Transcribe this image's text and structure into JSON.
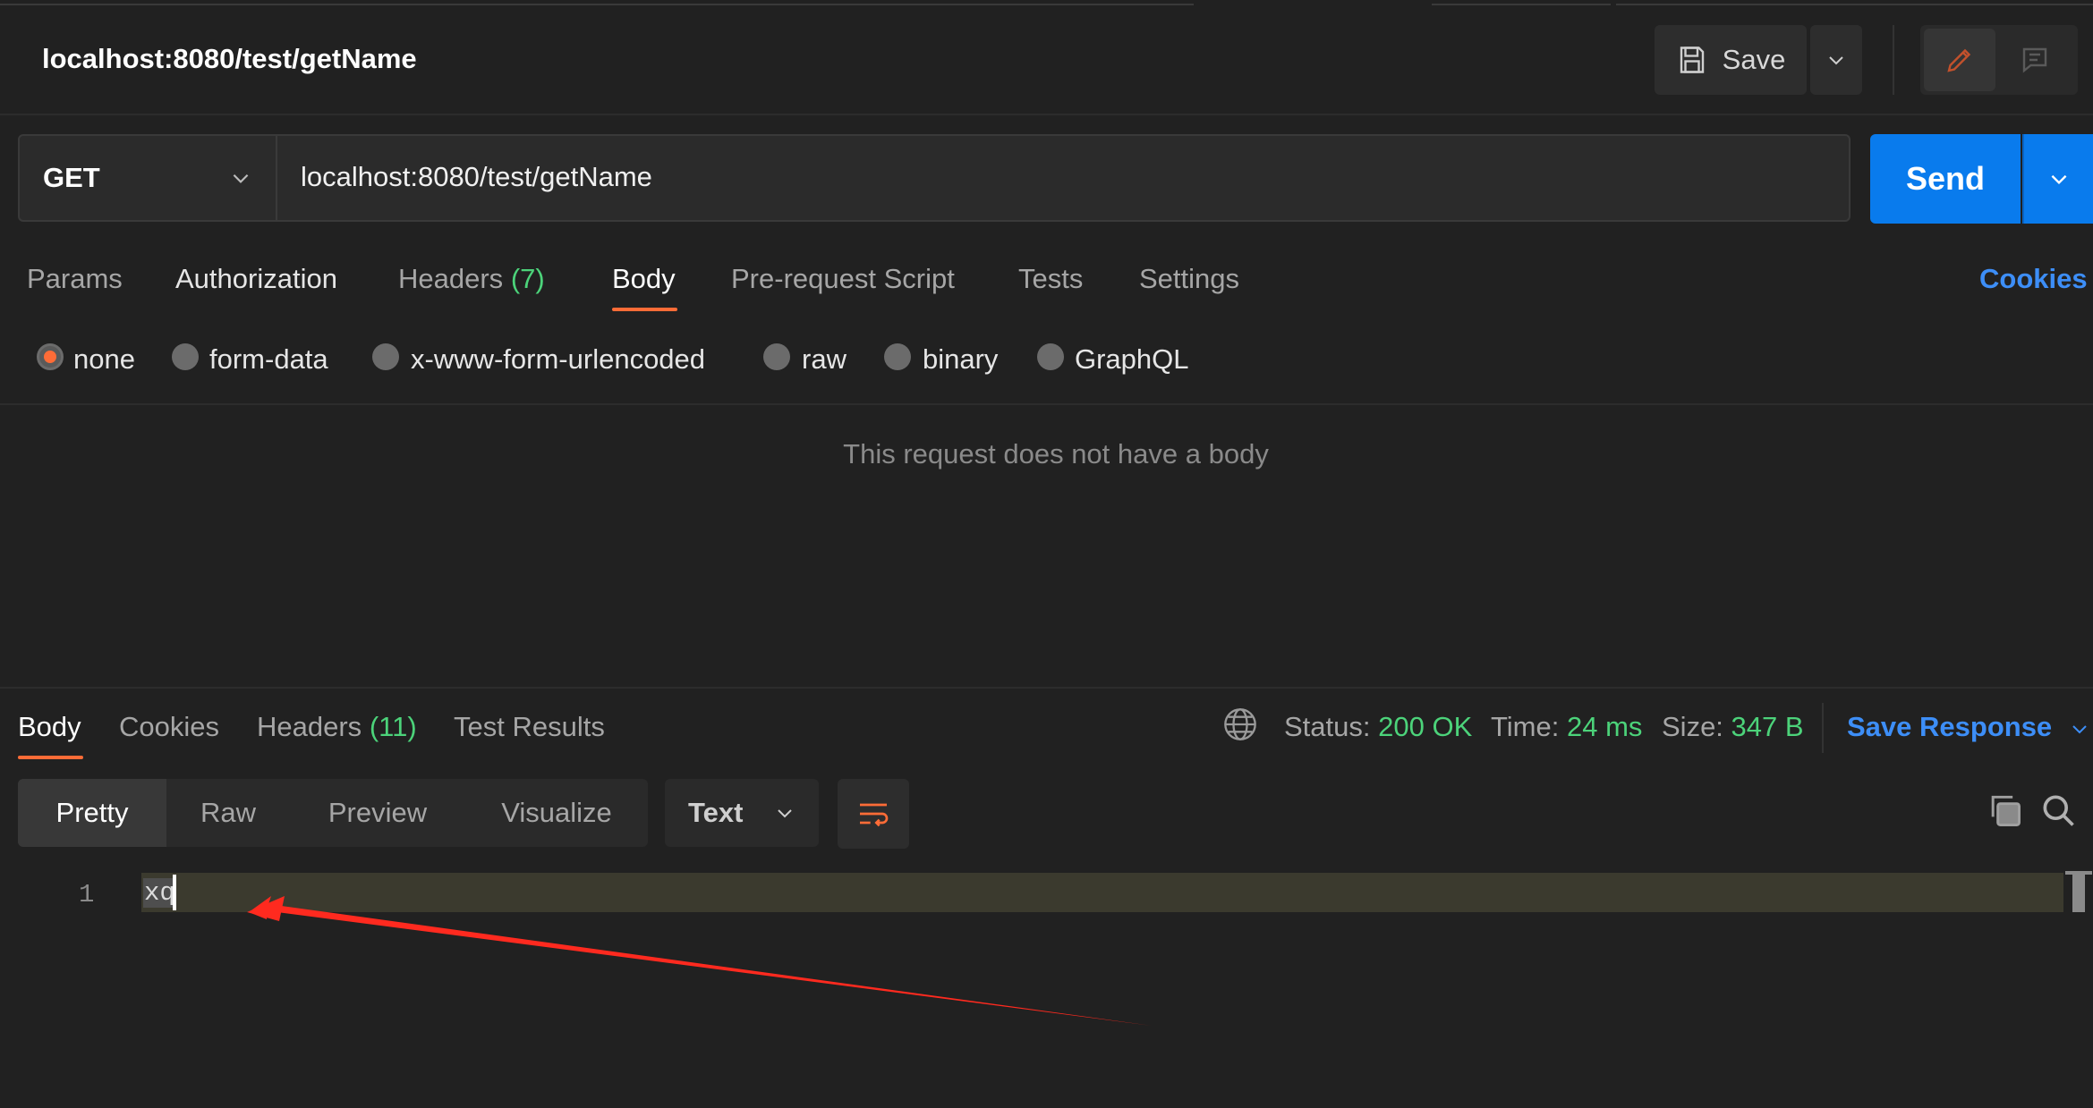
{
  "header": {
    "request_title": "localhost:8080/test/getName",
    "save_label": "Save"
  },
  "request": {
    "method": "GET",
    "url": "localhost:8080/test/getName",
    "send_label": "Send"
  },
  "request_tabs": {
    "params": "Params",
    "authorization": "Authorization",
    "headers": "Headers",
    "headers_count": "(7)",
    "body": "Body",
    "pre_request_script": "Pre-request Script",
    "tests": "Tests",
    "settings": "Settings",
    "cookies": "Cookies",
    "active": "Body"
  },
  "body_types": {
    "selected": "none",
    "options": [
      "none",
      "form-data",
      "x-www-form-urlencoded",
      "raw",
      "binary",
      "GraphQL"
    ]
  },
  "body_empty_message": "This request does not have a body",
  "response": {
    "tabs": {
      "body": "Body",
      "cookies": "Cookies",
      "headers": "Headers",
      "headers_count": "(11)",
      "test_results": "Test Results",
      "active": "Body"
    },
    "status_label": "Status:",
    "status_value": "200 OK",
    "time_label": "Time:",
    "time_value": "24 ms",
    "size_label": "Size:",
    "size_value": "347 B",
    "save_response": "Save Response",
    "views": [
      "Pretty",
      "Raw",
      "Preview",
      "Visualize"
    ],
    "active_view": "Pretty",
    "format": "Text",
    "lines": [
      {
        "number": "1",
        "text": "xq"
      }
    ]
  },
  "colors": {
    "background": "#212121",
    "accent_orange": "#ff6c37",
    "send_blue": "#097bed",
    "link_blue": "#3d8ef7",
    "success_green": "#4cd37a",
    "annotation_red": "#ff2a1f"
  },
  "icons": [
    "save-icon",
    "chevron-down-icon",
    "pencil-icon",
    "comment-icon",
    "globe-icon",
    "wrap-lines-icon",
    "copy-icon",
    "search-icon",
    "annotation-arrow"
  ]
}
